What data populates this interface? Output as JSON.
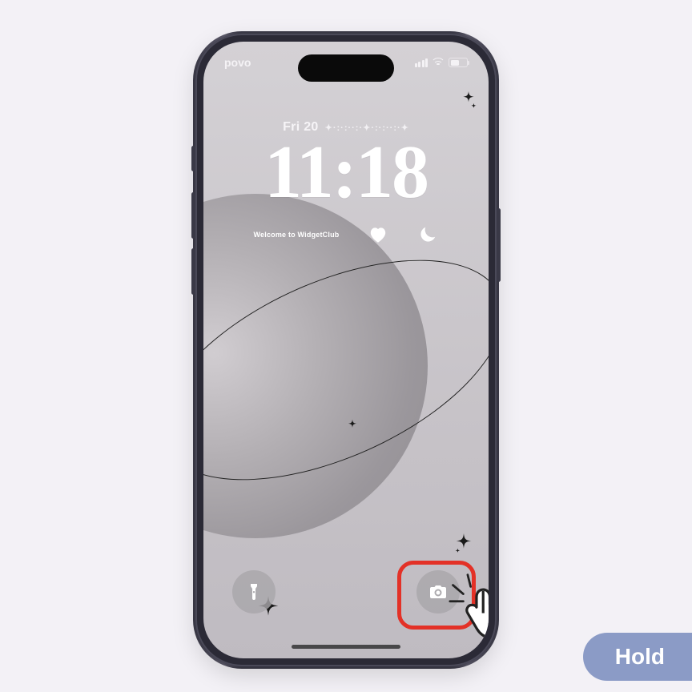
{
  "status": {
    "carrier": "povo"
  },
  "lock": {
    "date": "Fri 20",
    "date_decor": "✦·:·:··:·✦·:·:··:·✦",
    "time": "11:18",
    "welcome": "Welcome to WidgetClub"
  },
  "overlay": {
    "hold_label": "Hold"
  }
}
